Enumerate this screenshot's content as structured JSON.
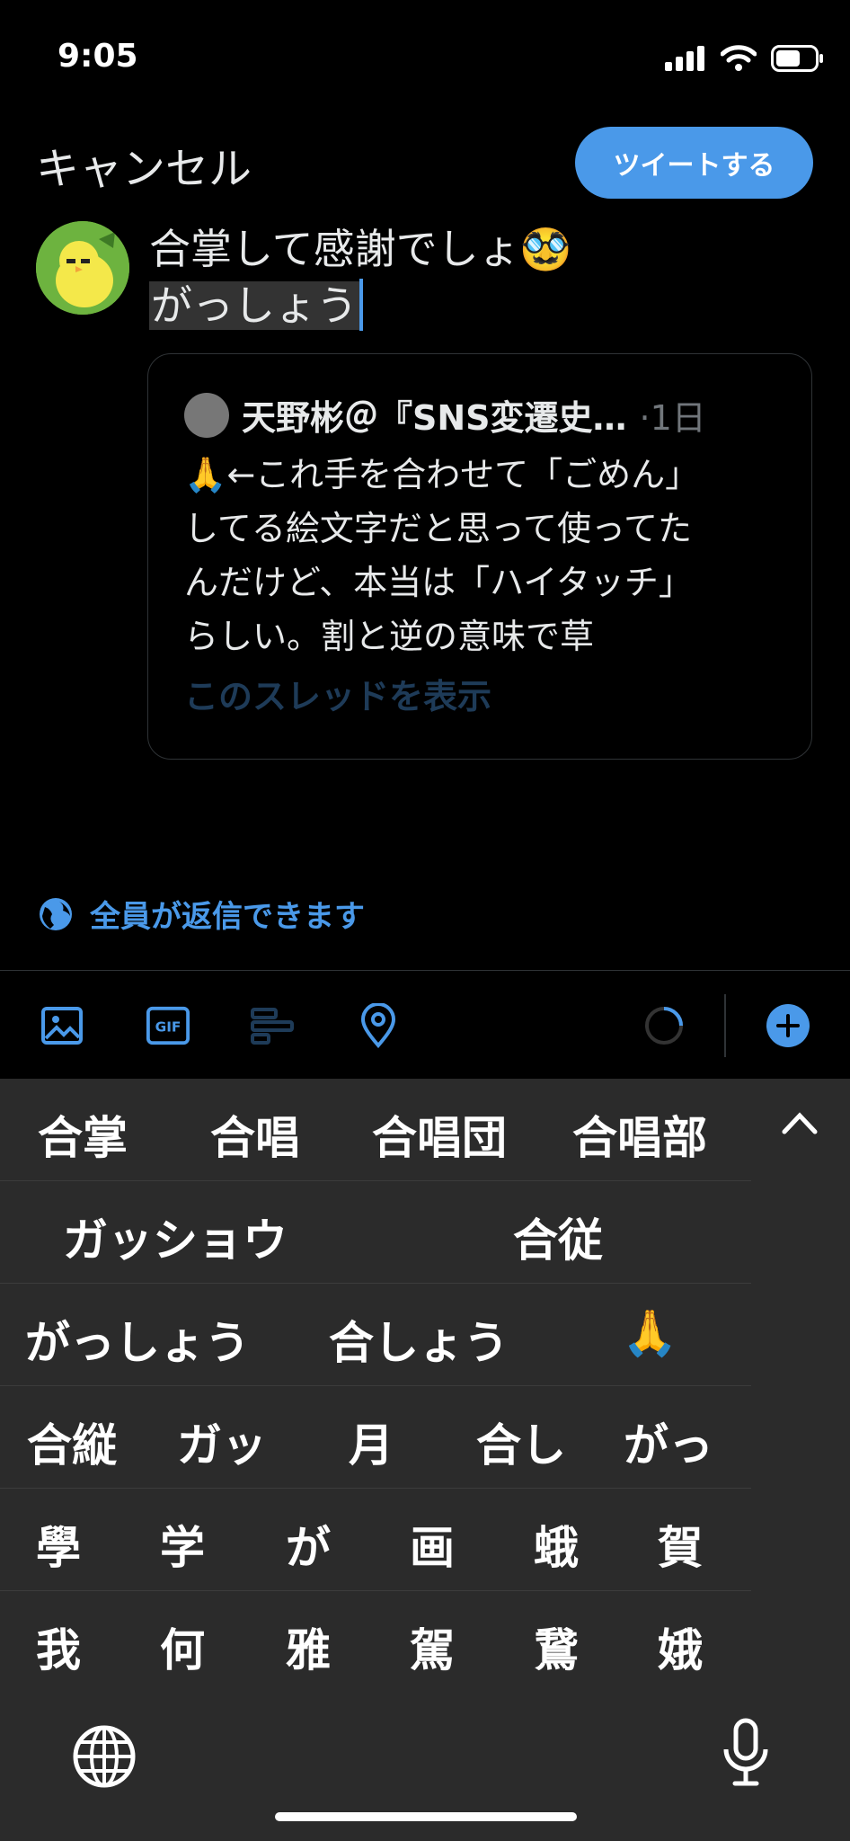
{
  "status_bar": {
    "time": "9:05"
  },
  "header": {
    "cancel_label": "キャンセル",
    "tweet_label": "ツイートする"
  },
  "compose": {
    "line1": "合掌して感謝でしょ",
    "line1_emoji": "🥸",
    "line2": "がっしょう"
  },
  "quote": {
    "author": "天野彬＠『SNS変遷史…",
    "time": "·1日",
    "emoji": "🙏",
    "lines": [
      "←これ手を合わせて「ごめん」",
      "してる絵文字だと思って使ってた",
      "んだけど、本当は「ハイタッチ」",
      "らしい。割と逆の意味で草"
    ],
    "thread_link": "このスレッドを表示"
  },
  "reply_setting": {
    "label": "全員が返信できます"
  },
  "toolbar": {
    "gif_label": "GIF"
  },
  "keyboard": {
    "rows": [
      [
        "合掌",
        "合唱",
        "合唱団",
        "合唱部"
      ],
      [
        "ガッショウ",
        "合従"
      ],
      [
        "がっしょう",
        "合しょう",
        "🙏"
      ],
      [
        "合縦",
        "ガッ",
        "月",
        "合し",
        "がっ"
      ],
      [
        "學",
        "学",
        "が",
        "画",
        "蛾",
        "賀"
      ],
      [
        "我",
        "何",
        "雅",
        "駕",
        "鵞",
        "娥"
      ]
    ]
  },
  "colors": {
    "accent": "#4a99e9",
    "background": "#000000",
    "keyboard": "#2b2b2b"
  }
}
